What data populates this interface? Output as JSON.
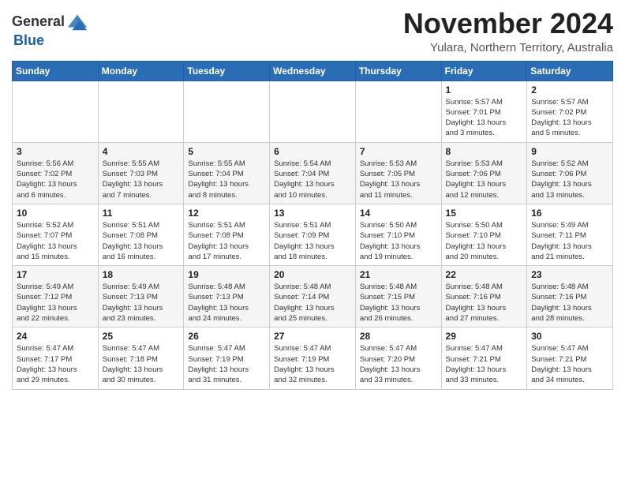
{
  "header": {
    "logo_line1": "General",
    "logo_line2": "Blue",
    "month": "November 2024",
    "location": "Yulara, Northern Territory, Australia"
  },
  "days_of_week": [
    "Sunday",
    "Monday",
    "Tuesday",
    "Wednesday",
    "Thursday",
    "Friday",
    "Saturday"
  ],
  "weeks": [
    [
      {
        "day": "",
        "info": ""
      },
      {
        "day": "",
        "info": ""
      },
      {
        "day": "",
        "info": ""
      },
      {
        "day": "",
        "info": ""
      },
      {
        "day": "",
        "info": ""
      },
      {
        "day": "1",
        "info": "Sunrise: 5:57 AM\nSunset: 7:01 PM\nDaylight: 13 hours\nand 3 minutes."
      },
      {
        "day": "2",
        "info": "Sunrise: 5:57 AM\nSunset: 7:02 PM\nDaylight: 13 hours\nand 5 minutes."
      }
    ],
    [
      {
        "day": "3",
        "info": "Sunrise: 5:56 AM\nSunset: 7:02 PM\nDaylight: 13 hours\nand 6 minutes."
      },
      {
        "day": "4",
        "info": "Sunrise: 5:55 AM\nSunset: 7:03 PM\nDaylight: 13 hours\nand 7 minutes."
      },
      {
        "day": "5",
        "info": "Sunrise: 5:55 AM\nSunset: 7:04 PM\nDaylight: 13 hours\nand 8 minutes."
      },
      {
        "day": "6",
        "info": "Sunrise: 5:54 AM\nSunset: 7:04 PM\nDaylight: 13 hours\nand 10 minutes."
      },
      {
        "day": "7",
        "info": "Sunrise: 5:53 AM\nSunset: 7:05 PM\nDaylight: 13 hours\nand 11 minutes."
      },
      {
        "day": "8",
        "info": "Sunrise: 5:53 AM\nSunset: 7:06 PM\nDaylight: 13 hours\nand 12 minutes."
      },
      {
        "day": "9",
        "info": "Sunrise: 5:52 AM\nSunset: 7:06 PM\nDaylight: 13 hours\nand 13 minutes."
      }
    ],
    [
      {
        "day": "10",
        "info": "Sunrise: 5:52 AM\nSunset: 7:07 PM\nDaylight: 13 hours\nand 15 minutes."
      },
      {
        "day": "11",
        "info": "Sunrise: 5:51 AM\nSunset: 7:08 PM\nDaylight: 13 hours\nand 16 minutes."
      },
      {
        "day": "12",
        "info": "Sunrise: 5:51 AM\nSunset: 7:08 PM\nDaylight: 13 hours\nand 17 minutes."
      },
      {
        "day": "13",
        "info": "Sunrise: 5:51 AM\nSunset: 7:09 PM\nDaylight: 13 hours\nand 18 minutes."
      },
      {
        "day": "14",
        "info": "Sunrise: 5:50 AM\nSunset: 7:10 PM\nDaylight: 13 hours\nand 19 minutes."
      },
      {
        "day": "15",
        "info": "Sunrise: 5:50 AM\nSunset: 7:10 PM\nDaylight: 13 hours\nand 20 minutes."
      },
      {
        "day": "16",
        "info": "Sunrise: 5:49 AM\nSunset: 7:11 PM\nDaylight: 13 hours\nand 21 minutes."
      }
    ],
    [
      {
        "day": "17",
        "info": "Sunrise: 5:49 AM\nSunset: 7:12 PM\nDaylight: 13 hours\nand 22 minutes."
      },
      {
        "day": "18",
        "info": "Sunrise: 5:49 AM\nSunset: 7:13 PM\nDaylight: 13 hours\nand 23 minutes."
      },
      {
        "day": "19",
        "info": "Sunrise: 5:48 AM\nSunset: 7:13 PM\nDaylight: 13 hours\nand 24 minutes."
      },
      {
        "day": "20",
        "info": "Sunrise: 5:48 AM\nSunset: 7:14 PM\nDaylight: 13 hours\nand 25 minutes."
      },
      {
        "day": "21",
        "info": "Sunrise: 5:48 AM\nSunset: 7:15 PM\nDaylight: 13 hours\nand 26 minutes."
      },
      {
        "day": "22",
        "info": "Sunrise: 5:48 AM\nSunset: 7:16 PM\nDaylight: 13 hours\nand 27 minutes."
      },
      {
        "day": "23",
        "info": "Sunrise: 5:48 AM\nSunset: 7:16 PM\nDaylight: 13 hours\nand 28 minutes."
      }
    ],
    [
      {
        "day": "24",
        "info": "Sunrise: 5:47 AM\nSunset: 7:17 PM\nDaylight: 13 hours\nand 29 minutes."
      },
      {
        "day": "25",
        "info": "Sunrise: 5:47 AM\nSunset: 7:18 PM\nDaylight: 13 hours\nand 30 minutes."
      },
      {
        "day": "26",
        "info": "Sunrise: 5:47 AM\nSunset: 7:19 PM\nDaylight: 13 hours\nand 31 minutes."
      },
      {
        "day": "27",
        "info": "Sunrise: 5:47 AM\nSunset: 7:19 PM\nDaylight: 13 hours\nand 32 minutes."
      },
      {
        "day": "28",
        "info": "Sunrise: 5:47 AM\nSunset: 7:20 PM\nDaylight: 13 hours\nand 33 minutes."
      },
      {
        "day": "29",
        "info": "Sunrise: 5:47 AM\nSunset: 7:21 PM\nDaylight: 13 hours\nand 33 minutes."
      },
      {
        "day": "30",
        "info": "Sunrise: 5:47 AM\nSunset: 7:21 PM\nDaylight: 13 hours\nand 34 minutes."
      }
    ]
  ]
}
